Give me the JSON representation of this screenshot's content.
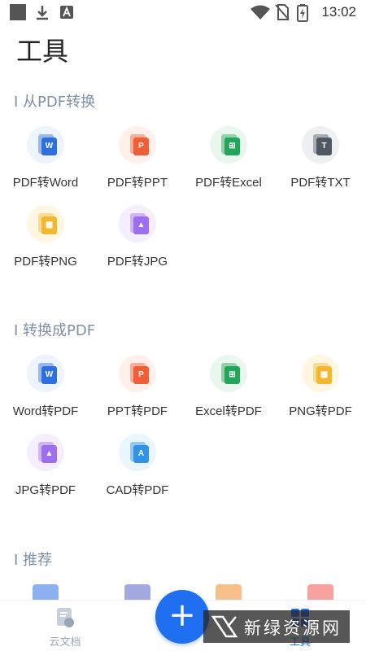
{
  "status_bar": {
    "time": "13:02",
    "left_icons": [
      "app-square-icon",
      "download-icon",
      "a-badge-icon"
    ],
    "right_icons": [
      "wifi-icon",
      "no-sim-icon",
      "battery-charging-icon"
    ]
  },
  "page": {
    "title": "工具"
  },
  "sections": [
    {
      "title": "I 从PDF转换",
      "tools": [
        {
          "label": "PDF转Word",
          "glyph": "W",
          "color": "#2d6fe3",
          "icon": "word-doc-icon"
        },
        {
          "label": "PDF转PPT",
          "glyph": "P",
          "color": "#f05e35",
          "icon": "ppt-doc-icon"
        },
        {
          "label": "PDF转Excel",
          "glyph": "⊞",
          "color": "#23a55a",
          "icon": "excel-doc-icon"
        },
        {
          "label": "PDF转TXT",
          "glyph": "T",
          "color": "#4f5863",
          "icon": "txt-doc-icon"
        },
        {
          "label": "PDF转PNG",
          "glyph": "▦",
          "color": "#f3b72e",
          "icon": "png-image-icon"
        },
        {
          "label": "PDF转JPG",
          "glyph": "▲",
          "color": "#9d6ff0",
          "icon": "jpg-image-icon"
        }
      ]
    },
    {
      "title": "I 转换成PDF",
      "tools": [
        {
          "label": "Word转PDF",
          "glyph": "W",
          "color": "#2d6fe3",
          "icon": "word-doc-icon"
        },
        {
          "label": "PPT转PDF",
          "glyph": "P",
          "color": "#f05e35",
          "icon": "ppt-doc-icon"
        },
        {
          "label": "Excel转PDF",
          "glyph": "⊞",
          "color": "#23a55a",
          "icon": "excel-doc-icon"
        },
        {
          "label": "PNG转PDF",
          "glyph": "▦",
          "color": "#f3b72e",
          "icon": "png-image-icon"
        },
        {
          "label": "JPG转PDF",
          "glyph": "▲",
          "color": "#9d6ff0",
          "icon": "jpg-image-icon"
        },
        {
          "label": "CAD转PDF",
          "glyph": "A",
          "color": "#2f93e6",
          "icon": "cad-doc-icon"
        }
      ]
    },
    {
      "title": "I 推荐",
      "tools": []
    }
  ],
  "bottom_nav": {
    "items": [
      {
        "label": "云文档",
        "icon": "cloud-doc-icon",
        "active": false
      },
      {
        "label": "工具",
        "icon": "toolbox-icon",
        "active": true
      }
    ],
    "fab_glyph": "+",
    "active_color": "#1f6ff0",
    "inactive_color": "#9aa6b8"
  },
  "watermark": {
    "text": "新绿资源网"
  }
}
